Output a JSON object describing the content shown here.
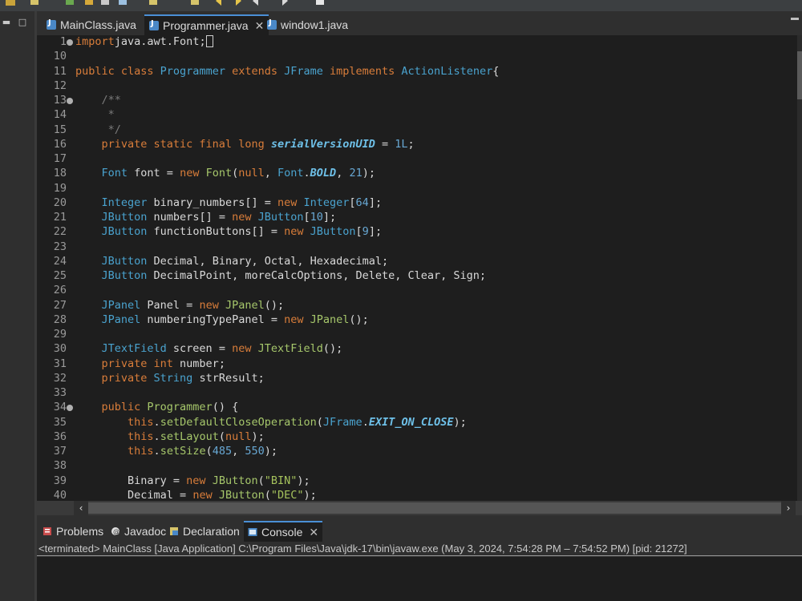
{
  "editor_tabs": [
    {
      "label": "MainClass.java",
      "icon": "java-file-icon",
      "active": false
    },
    {
      "label": "Programmer.java",
      "icon": "java-file-icon",
      "active": true,
      "close": "✕"
    },
    {
      "label": "window1.java",
      "icon": "java-file-icon",
      "active": false
    }
  ],
  "code_lines": [
    {
      "no": "1",
      "fold": true,
      "segs": [
        [
          "kw",
          "import"
        ],
        [
          "",
          "java.awt.Font;"
        ]
      ],
      "cursor": true
    },
    {
      "no": "10",
      "segs": []
    },
    {
      "no": "11",
      "segs": [
        [
          "kw",
          "public class "
        ],
        [
          "cls",
          "Programmer "
        ],
        [
          "kw",
          "extends "
        ],
        [
          "cls",
          "JFrame "
        ],
        [
          "kw",
          "implements "
        ],
        [
          "cls",
          "ActionListener"
        ],
        [
          "",
          "{"
        ]
      ]
    },
    {
      "no": "12",
      "segs": []
    },
    {
      "no": "13",
      "fold": true,
      "segs": [
        [
          "cm",
          "    /**"
        ]
      ]
    },
    {
      "no": "14",
      "segs": [
        [
          "cm",
          "     *"
        ]
      ]
    },
    {
      "no": "15",
      "segs": [
        [
          "cm",
          "     */"
        ]
      ]
    },
    {
      "no": "16",
      "segs": [
        [
          "kw",
          "    private static final long "
        ],
        [
          "cst",
          "serialVersionUID"
        ],
        [
          "",
          " = "
        ],
        [
          "num",
          "1L"
        ],
        [
          "",
          ";"
        ]
      ]
    },
    {
      "no": "17",
      "segs": []
    },
    {
      "no": "18",
      "segs": [
        [
          "cls",
          "    Font "
        ],
        [
          "",
          "font = "
        ],
        [
          "kw",
          "new "
        ],
        [
          "fn",
          "Font"
        ],
        [
          "",
          "("
        ],
        [
          "kw",
          "null"
        ],
        [
          ", ",
          ""
        ],
        [
          "",
          ", "
        ],
        [
          "cls",
          "Font"
        ],
        [
          "",
          "."
        ],
        [
          "cst",
          "BOLD"
        ],
        [
          "",
          ", "
        ],
        [
          "num",
          "21"
        ],
        [
          "",
          ");"
        ]
      ]
    },
    {
      "no": "19",
      "segs": []
    },
    {
      "no": "20",
      "segs": [
        [
          "cls",
          "    Integer "
        ],
        [
          "",
          "binary_numbers[] = "
        ],
        [
          "kw",
          "new "
        ],
        [
          "cls",
          "Integer"
        ],
        [
          "",
          "["
        ],
        [
          "num",
          "64"
        ],
        [
          "",
          "];"
        ]
      ]
    },
    {
      "no": "21",
      "segs": [
        [
          "cls",
          "    JButton "
        ],
        [
          "",
          "numbers[] = "
        ],
        [
          "kw",
          "new "
        ],
        [
          "cls",
          "JButton"
        ],
        [
          "",
          "["
        ],
        [
          "num",
          "10"
        ],
        [
          "",
          "];"
        ]
      ]
    },
    {
      "no": "22",
      "segs": [
        [
          "cls",
          "    JButton "
        ],
        [
          "",
          "functionButtons[] = "
        ],
        [
          "kw",
          "new "
        ],
        [
          "cls",
          "JButton"
        ],
        [
          "",
          "["
        ],
        [
          "num",
          "9"
        ],
        [
          "",
          "];"
        ]
      ]
    },
    {
      "no": "23",
      "segs": []
    },
    {
      "no": "24",
      "segs": [
        [
          "cls",
          "    JButton "
        ],
        [
          "",
          "Decimal, Binary, Octal, Hexadecimal;"
        ]
      ]
    },
    {
      "no": "25",
      "segs": [
        [
          "cls",
          "    JButton "
        ],
        [
          "",
          "DecimalPoint, moreCalcOptions, Delete, Clear, Sign;"
        ]
      ]
    },
    {
      "no": "26",
      "segs": []
    },
    {
      "no": "27",
      "segs": [
        [
          "cls",
          "    JPanel "
        ],
        [
          "",
          "Panel = "
        ],
        [
          "kw",
          "new "
        ],
        [
          "fn",
          "JPanel"
        ],
        [
          "",
          "();"
        ]
      ]
    },
    {
      "no": "28",
      "segs": [
        [
          "cls",
          "    JPanel "
        ],
        [
          "",
          "numberingTypePanel = "
        ],
        [
          "kw",
          "new "
        ],
        [
          "fn",
          "JPanel"
        ],
        [
          "",
          "();"
        ]
      ]
    },
    {
      "no": "29",
      "segs": []
    },
    {
      "no": "30",
      "segs": [
        [
          "cls",
          "    JTextField "
        ],
        [
          "",
          "screen = "
        ],
        [
          "kw",
          "new "
        ],
        [
          "fn",
          "JTextField"
        ],
        [
          "",
          "();"
        ]
      ]
    },
    {
      "no": "31",
      "segs": [
        [
          "kw",
          "    private int "
        ],
        [
          "",
          "number;"
        ]
      ]
    },
    {
      "no": "32",
      "segs": [
        [
          "kw",
          "    private "
        ],
        [
          "cls",
          "String "
        ],
        [
          "",
          "strResult;"
        ]
      ]
    },
    {
      "no": "33",
      "segs": []
    },
    {
      "no": "34",
      "fold": true,
      "segs": [
        [
          "kw",
          "    public "
        ],
        [
          "fn",
          "Programmer"
        ],
        [
          "",
          "() {"
        ]
      ]
    },
    {
      "no": "35",
      "segs": [
        [
          "kw",
          "        this"
        ],
        [
          "",
          "."
        ],
        [
          "fn",
          "setDefaultCloseOperation"
        ],
        [
          "",
          "("
        ],
        [
          "cls",
          "JFrame"
        ],
        [
          "",
          "."
        ],
        [
          "cst",
          "EXIT_ON_CLOSE"
        ],
        [
          "",
          ");"
        ]
      ]
    },
    {
      "no": "36",
      "segs": [
        [
          "kw",
          "        this"
        ],
        [
          "",
          "."
        ],
        [
          "fn",
          "setLayout"
        ],
        [
          "",
          "("
        ],
        [
          "kw",
          "null"
        ],
        [
          "",
          ");"
        ]
      ]
    },
    {
      "no": "37",
      "segs": [
        [
          "kw",
          "        this"
        ],
        [
          "",
          "."
        ],
        [
          "fn",
          "setSize"
        ],
        [
          "",
          "("
        ],
        [
          "num",
          "485"
        ],
        [
          "",
          ", "
        ],
        [
          "num",
          "550"
        ],
        [
          "",
          ");"
        ]
      ]
    },
    {
      "no": "38",
      "segs": []
    },
    {
      "no": "39",
      "segs": [
        [
          "",
          "        Binary = "
        ],
        [
          "kw",
          "new "
        ],
        [
          "fn",
          "JButton"
        ],
        [
          "",
          "("
        ],
        [
          "str",
          "\"BIN\""
        ],
        [
          "",
          ");"
        ]
      ]
    },
    {
      "no": "40",
      "segs": [
        [
          "",
          "        Decimal = "
        ],
        [
          "kw",
          "new "
        ],
        [
          "fn",
          "JButton"
        ],
        [
          "",
          "("
        ],
        [
          "str",
          "\"DEC\""
        ],
        [
          "",
          ");"
        ]
      ]
    }
  ],
  "panel_tabs": [
    {
      "label": "Problems",
      "icon": "problems-icon",
      "active": false
    },
    {
      "label": "Javadoc",
      "icon": "javadoc-icon",
      "active": false
    },
    {
      "label": "Declaration",
      "icon": "declaration-icon",
      "active": false
    },
    {
      "label": "Console",
      "icon": "console-icon",
      "active": true,
      "close": "✕"
    }
  ],
  "console": {
    "status": "<terminated> MainClass [Java Application] C:\\Program Files\\Java\\jdk-17\\bin\\javaw.exe  (May 3, 2024, 7:54:28 PM – 7:54:52 PM) [pid: 21272]"
  },
  "colors": {
    "keyword": "#d97d3a",
    "class": "#4aa3cf",
    "method": "#a6c76b",
    "comment": "#7a7a7a",
    "number": "#68a8d4",
    "accent": "#4a8fd6",
    "editor_bg": "#1e1e1e"
  }
}
